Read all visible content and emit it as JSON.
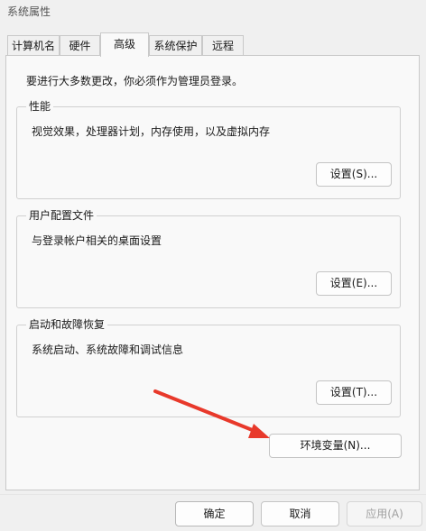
{
  "window": {
    "title": "系统属性"
  },
  "tabs": [
    {
      "label": "计算机名"
    },
    {
      "label": "硬件"
    },
    {
      "label": "高级"
    },
    {
      "label": "系统保护"
    },
    {
      "label": "远程"
    }
  ],
  "intro": "要进行大多数更改，你必须作为管理员登录。",
  "groups": {
    "performance": {
      "title": "性能",
      "desc": "视觉效果，处理器计划，内存使用，以及虚拟内存",
      "button": "设置(S)..."
    },
    "profile": {
      "title": "用户配置文件",
      "desc": "与登录帐户相关的桌面设置",
      "button": "设置(E)..."
    },
    "startup": {
      "title": "启动和故障恢复",
      "desc": "系统启动、系统故障和调试信息",
      "button": "设置(T)..."
    }
  },
  "env_button": "环境变量(N)...",
  "footer": {
    "ok": "确定",
    "cancel": "取消",
    "apply": "应用(A)"
  },
  "annotation": {
    "arrow_color": "#e8392b"
  }
}
